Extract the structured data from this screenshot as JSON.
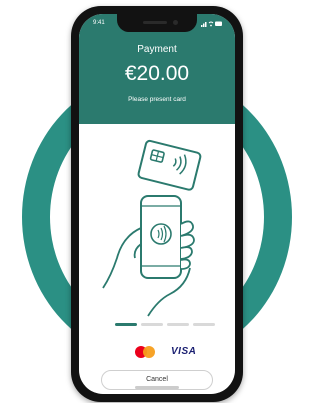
{
  "status_bar": {
    "time": "9:41",
    "icons": "▮ ≋ ▬"
  },
  "header": {
    "title": "Payment",
    "amount": "€20.00",
    "subtitle": "Please present card"
  },
  "progress": {
    "total_steps": 4,
    "current_step": 1
  },
  "brands": {
    "visa_label": "VISA",
    "mastercard_label": "mastercard"
  },
  "actions": {
    "cancel_label": "Cancel"
  },
  "colors": {
    "accent": "#2b7a6e",
    "ring": "#2f9d90",
    "progress_active": "#2b7a6e",
    "progress_inactive": "#d9d9d9"
  }
}
